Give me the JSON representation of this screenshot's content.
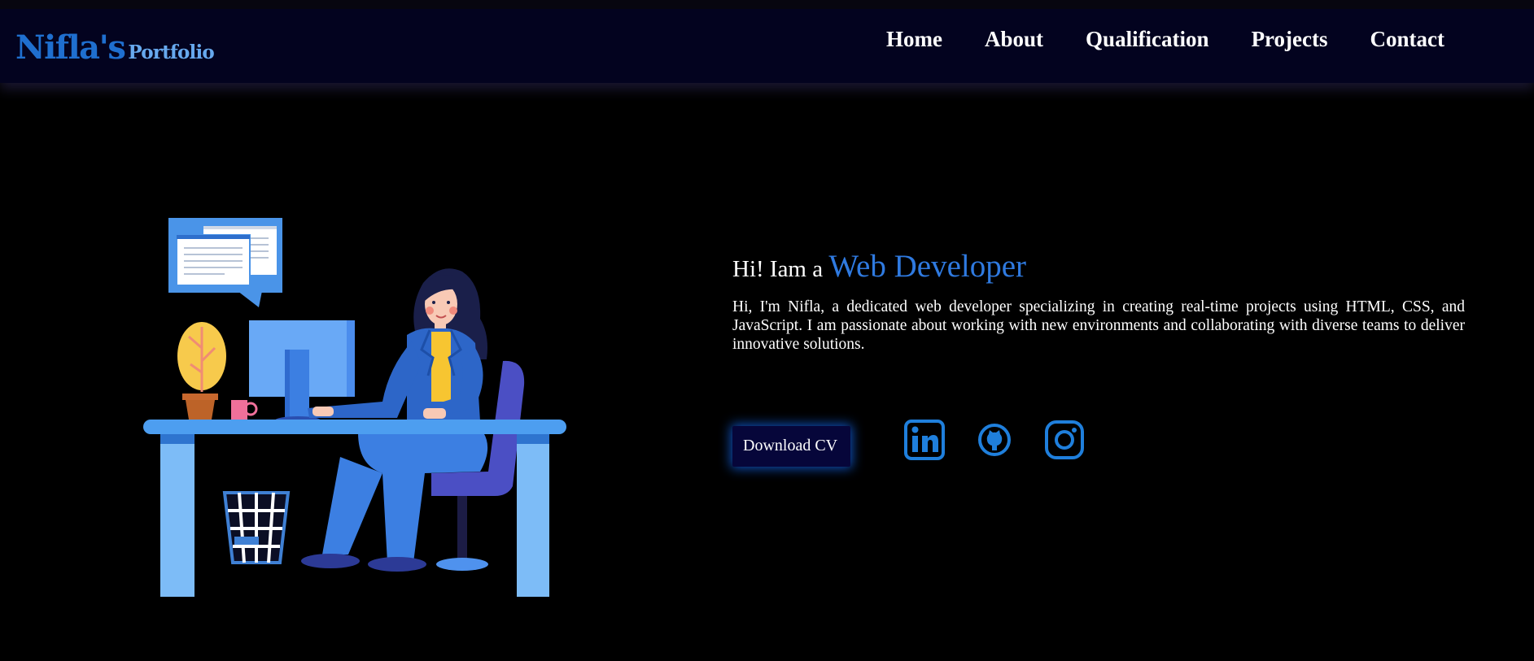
{
  "brand": {
    "name": "Nifla's",
    "suffix": "Portfolio"
  },
  "nav": {
    "items": [
      {
        "label": "Home"
      },
      {
        "label": "About"
      },
      {
        "label": "Qualification"
      },
      {
        "label": "Projects"
      },
      {
        "label": "Contact"
      }
    ]
  },
  "hero": {
    "greeting": "Hi! Iam a",
    "role": "Web Developer",
    "bio": "Hi, I'm Nifla, a dedicated web developer specializing in creating real-time projects using HTML, CSS, and JavaScript. I am passionate about working with new environments and collaborating with diverse teams to deliver innovative solutions.",
    "cv_label": "Download CV"
  },
  "socials": [
    {
      "icon": "linkedin-icon"
    },
    {
      "icon": "github-icon"
    },
    {
      "icon": "instagram-icon"
    }
  ],
  "colors": {
    "nav_background": "#03031f",
    "accent": "#2f7ae0",
    "logo": "#1f6fcf",
    "icon": "#1f7fdc",
    "button_background": "#06063a"
  }
}
